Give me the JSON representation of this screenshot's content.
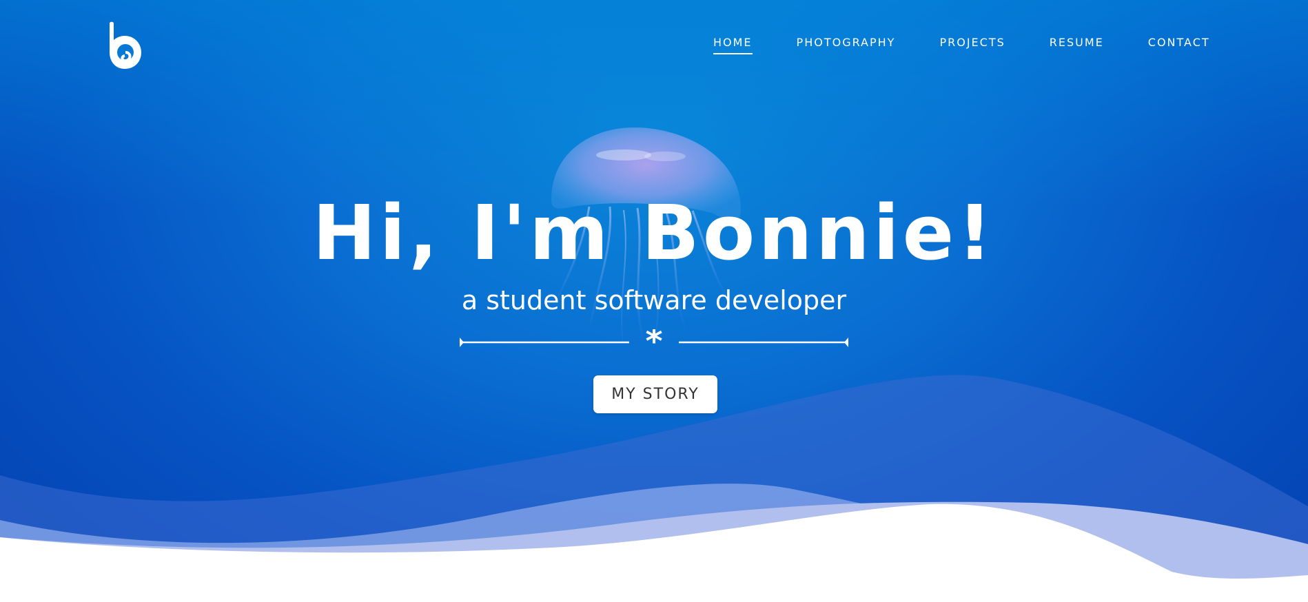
{
  "brand": {
    "logo_letter": "b"
  },
  "nav": {
    "items": [
      {
        "label": "HOME",
        "active": true
      },
      {
        "label": "PHOTOGRAPHY",
        "active": false
      },
      {
        "label": "PROJECTS",
        "active": false
      },
      {
        "label": "RESUME",
        "active": false
      },
      {
        "label": "CONTACT",
        "active": false
      }
    ]
  },
  "hero": {
    "title": "Hi, I'm Bonnie!",
    "subtitle": "a student software developer",
    "divider_symbol": "*",
    "cta_label": "MY STORY"
  },
  "colors": {
    "hero_blue": "#0a6fd2",
    "deep_blue": "#0440b0",
    "text": "#ffffff",
    "button_text": "#333333",
    "wave_light": "#b0bfee",
    "wave_mid": "#6c92e0"
  },
  "icons": {
    "logo": "b-logo-icon",
    "divider": "asterisk-divider-icon",
    "background": "jellyfish-image"
  }
}
